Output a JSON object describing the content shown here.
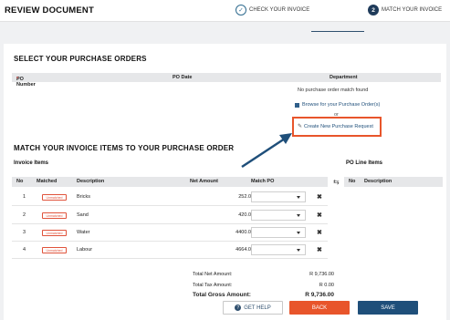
{
  "header": {
    "title": "REVIEW DOCUMENT"
  },
  "steps": [
    {
      "label": "CHECK YOUR INVOICE",
      "icon": "check-icon"
    },
    {
      "label": "MATCH YOUR INVOICE",
      "number": "2"
    }
  ],
  "purchase_orders": {
    "title": "SELECT YOUR PURCHASE ORDERS",
    "columns": {
      "po_number": "PO Number",
      "required_mark": "*",
      "po_date": "PO Date",
      "department": "Department"
    },
    "empty_text": "No purchase order match found",
    "browse_link": "Browse for your Purchase Order(s)",
    "or_text": "or",
    "create_link": "Create New Purchase Request"
  },
  "match": {
    "title": "MATCH YOUR INVOICE ITEMS TO YOUR PURCHASE ORDER",
    "invoice_items_label": "Invoice Items",
    "po_line_items_label": "PO Line Items",
    "invoice_columns": {
      "no": "No",
      "matched": "Matched",
      "description": "Description",
      "net_amount": "Net Amount",
      "match_po": "Match PO"
    },
    "po_columns": {
      "no": "No",
      "description": "Description"
    },
    "rows": [
      {
        "no": "1",
        "status": "Unmatched",
        "description": "Bricks",
        "amount": "252.0"
      },
      {
        "no": "2",
        "status": "Unmatched",
        "description": "Sand",
        "amount": "420.0"
      },
      {
        "no": "3",
        "status": "Unmatched",
        "description": "Water",
        "amount": "4400.0"
      },
      {
        "no": "4",
        "status": "Unmatched",
        "description": "Labour",
        "amount": "4664.0"
      }
    ]
  },
  "totals": {
    "net_label": "Total Net Amount:",
    "net_value": "R 9,736.00",
    "tax_label": "Total Tax Amount:",
    "tax_value": "R 0.00",
    "gross_label": "Total Gross Amount:",
    "gross_value": "R 9,736.00"
  },
  "buttons": {
    "help": "GET HELP",
    "back": "BACK",
    "save": "SAVE"
  },
  "colors": {
    "accent": "#e8552b",
    "primary": "#1f4f7a",
    "dark": "#1f3b5a"
  }
}
